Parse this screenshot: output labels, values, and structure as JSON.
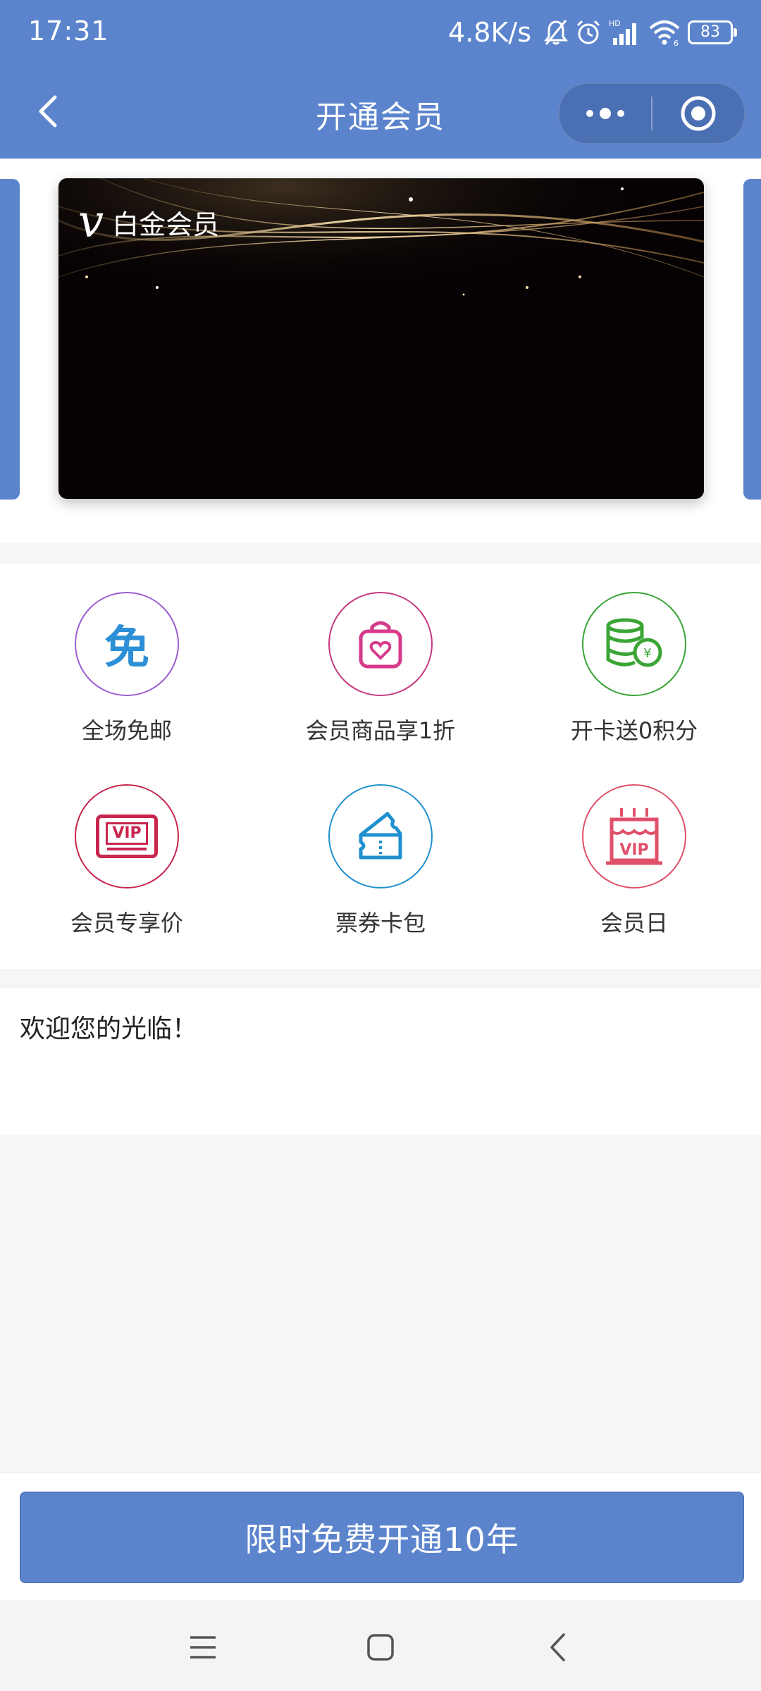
{
  "status_bar": {
    "time": "17:31",
    "network_speed": "4.8K/s",
    "battery": "83",
    "icons": [
      "bell-off-icon",
      "alarm-icon",
      "signal-icon",
      "wifi-icon",
      "battery-icon"
    ]
  },
  "header": {
    "title": "开通会员",
    "back_icon": "chevron-left-icon",
    "capsule": {
      "more_icon": "more-dots-icon",
      "close_icon": "target-icon"
    }
  },
  "card": {
    "logo": "V",
    "name": "白金会员"
  },
  "benefits": [
    {
      "label": "全场免邮",
      "icon_text": "免",
      "icon": "free-shipping-icon",
      "color": "#2d8fd6",
      "ring": "#9a5fd0"
    },
    {
      "label": "会员商品享1折",
      "icon": "shopping-bag-heart-icon",
      "color": "#d63a8a",
      "ring": "#c6397f"
    },
    {
      "label": "开卡送0积分",
      "icon": "coins-icon",
      "color": "#3aa535",
      "ring": "#3aa535"
    },
    {
      "label": "会员专享价",
      "icon_text": "VIP",
      "icon": "vip-card-icon",
      "color": "#c8264e",
      "ring": "#c8264e"
    },
    {
      "label": "票券卡包",
      "icon": "ticket-icon",
      "color": "#1f90cf",
      "ring": "#1f90cf"
    },
    {
      "label": "会员日",
      "icon_text": "VIP",
      "icon": "birthday-cake-icon",
      "color": "#e0506a",
      "ring": "#e0506a"
    }
  ],
  "welcome": {
    "text": "欢迎您的光临！"
  },
  "cta": {
    "label": "限时免费开通10年"
  },
  "system_nav": {
    "icons": [
      "menu-icon",
      "home-icon",
      "back-icon"
    ]
  },
  "colors": {
    "primary": "#5b84cd",
    "capsule": "#4a6fb3"
  }
}
